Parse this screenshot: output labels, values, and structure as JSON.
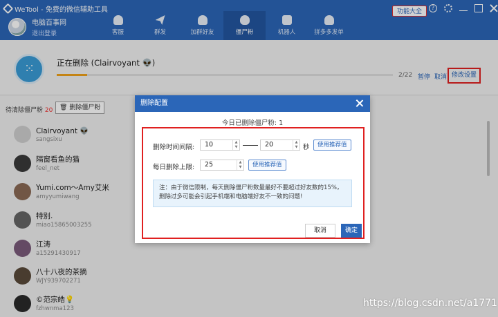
{
  "app": {
    "title": "WeTool - 免费的微信辅助工具",
    "profile_name": "电脑百事网",
    "logout": "退出登录",
    "func_btn": "功能大全",
    "help_glyph": "?"
  },
  "tabs": [
    {
      "label": "客服",
      "icon": "headset-icon"
    },
    {
      "label": "群发",
      "icon": "paper-plane-icon"
    },
    {
      "label": "加群好友",
      "icon": "add-person-icon"
    },
    {
      "label": "僵尸粉",
      "icon": "skull-icon",
      "active": true
    },
    {
      "label": "机器人",
      "icon": "robot-icon"
    },
    {
      "label": "拼多多发单",
      "icon": "person-icon"
    }
  ],
  "status": {
    "deleting_text": "正在删除 (Clairvoyant 👽)",
    "progress_fraction": 0.09,
    "count": "2/22",
    "pause": "暂停",
    "cancel": "取消",
    "modify": "修改设置"
  },
  "list": {
    "pending_label": "待清除僵尸粉",
    "pending_count": "20",
    "delete_btn": "删除僵尸粉",
    "contacts": [
      {
        "name": "Clairvoyant 👽",
        "id": "sangsixu"
      },
      {
        "name": "隔窗看鱼的猫",
        "id": "feel_net"
      },
      {
        "name": "Yumi.com～Amy艾米",
        "id": "amyyumiwang"
      },
      {
        "name": "特别.",
        "id": "miao15865003255"
      },
      {
        "name": "江涛",
        "id": "a15291430917"
      },
      {
        "name": "八十八夜的茶摘",
        "id": "WJY939702271"
      },
      {
        "name": "©范宗皓💡",
        "id": "fzhwnma123"
      }
    ]
  },
  "dialog": {
    "title": "删除配置",
    "today_count": "今日已删除僵尸粉: 1",
    "interval_label": "删除时间间隔:",
    "interval_min": "10",
    "interval_max": "20",
    "interval_unit": "秒",
    "recommend": "使用推荐值",
    "daily_label": "每日删除上限:",
    "daily_value": "25",
    "note": "注：由于微信限制，每天删除僵尸粉数量最好不要超过好友数的15%，删除过多可能会引起手机端和电脑端好友不一致的问题!",
    "cancel": "取消",
    "ok": "确定"
  },
  "watermark": "https://blog.csdn.net/a1771",
  "colors": {
    "header": "#2b66b8",
    "highlight": "#e02020",
    "progress": "#f0a21a"
  }
}
